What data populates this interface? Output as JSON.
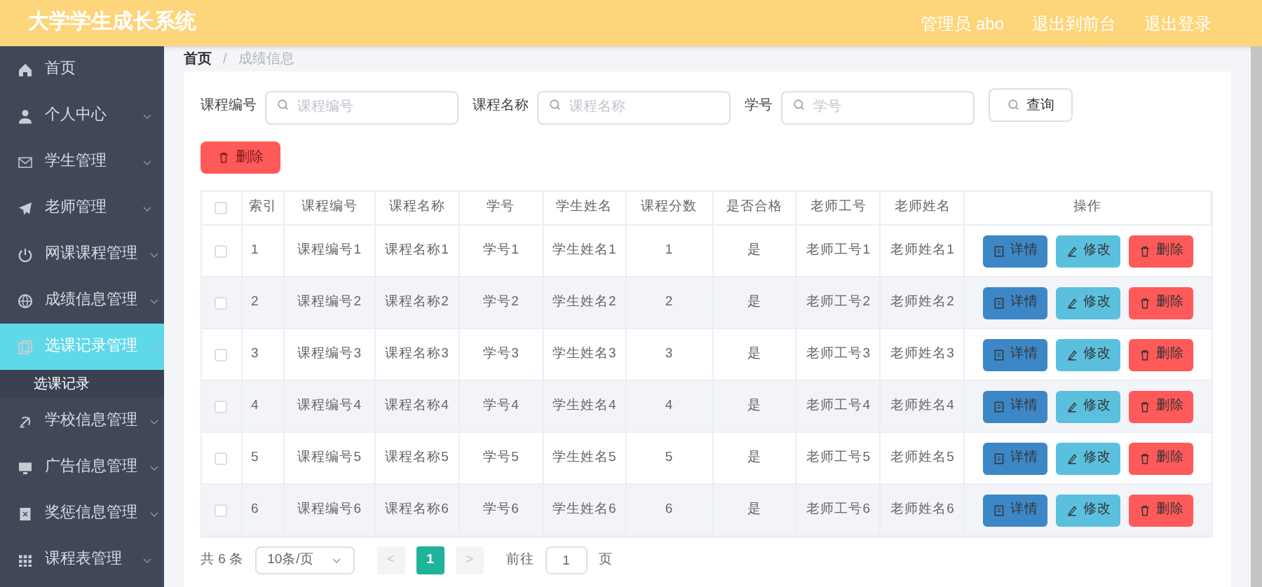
{
  "header": {
    "title": "大学学生成长系统",
    "user": "管理员 abo",
    "links": [
      "退出到前台",
      "退出登录"
    ]
  },
  "sidebar": {
    "items": [
      {
        "label": "首页",
        "kind": "link",
        "selected": false
      },
      {
        "label": "个人中心",
        "kind": "menu",
        "selected": false,
        "expanded": false
      },
      {
        "label": "学生管理",
        "kind": "menu",
        "selected": false,
        "expanded": false
      },
      {
        "label": "老师管理",
        "kind": "menu",
        "selected": false,
        "expanded": false
      },
      {
        "label": "网课课程管理",
        "kind": "menu",
        "selected": false,
        "expanded": false
      },
      {
        "label": "成绩信息管理",
        "kind": "menu",
        "selected": false,
        "expanded": false
      },
      {
        "label": "选课记录管理",
        "kind": "menu",
        "selected": true,
        "expanded": true,
        "children": [
          {
            "label": "选课记录"
          }
        ]
      },
      {
        "label": "学校信息管理",
        "kind": "menu",
        "selected": false,
        "expanded": false
      },
      {
        "label": "广告信息管理",
        "kind": "menu",
        "selected": false,
        "expanded": false
      },
      {
        "label": "奖惩信息管理",
        "kind": "menu",
        "selected": false,
        "expanded": false
      },
      {
        "label": "课程表管理",
        "kind": "menu",
        "selected": false,
        "expanded": false
      }
    ]
  },
  "breadcrumb": [
    "首页",
    "/",
    "成绩信息"
  ],
  "filters": [
    {
      "label": "课程编号",
      "placeholder": "课程编号"
    },
    {
      "label": "课程名称",
      "placeholder": "课程名称"
    },
    {
      "label": "学号",
      "placeholder": "学号"
    }
  ],
  "search_button": "查询",
  "delete_button": "删除",
  "table": {
    "select_all_checked": false,
    "columns": [
      "索引",
      "课程编号",
      "课程名称",
      "学号",
      "学生姓名",
      "课程分数",
      "是否合格",
      "老师工号",
      "老师姓名",
      "操作"
    ],
    "rows": [
      {
        "checked": false,
        "cells": [
          "1",
          "课程编号1",
          "课程名称1",
          "学号1",
          "学生姓名1",
          "1",
          "是",
          "老师工号1",
          "老师姓名1"
        ],
        "actions": [
          {
            "kind": "detail",
            "label": "详情"
          },
          {
            "kind": "edit",
            "label": "修改"
          },
          {
            "kind": "delete",
            "label": "删除"
          }
        ]
      },
      {
        "checked": false,
        "cells": [
          "2",
          "课程编号2",
          "课程名称2",
          "学号2",
          "学生姓名2",
          "2",
          "是",
          "老师工号2",
          "老师姓名2"
        ],
        "actions": [
          {
            "kind": "detail",
            "label": "详情"
          },
          {
            "kind": "edit",
            "label": "修改"
          },
          {
            "kind": "delete",
            "label": "删除"
          }
        ]
      },
      {
        "checked": false,
        "cells": [
          "3",
          "课程编号3",
          "课程名称3",
          "学号3",
          "学生姓名3",
          "3",
          "是",
          "老师工号3",
          "老师姓名3"
        ],
        "actions": [
          {
            "kind": "detail",
            "label": "详情"
          },
          {
            "kind": "edit",
            "label": "修改"
          },
          {
            "kind": "delete",
            "label": "删除"
          }
        ]
      },
      {
        "checked": false,
        "cells": [
          "4",
          "课程编号4",
          "课程名称4",
          "学号4",
          "学生姓名4",
          "4",
          "是",
          "老师工号4",
          "老师姓名4"
        ],
        "actions": [
          {
            "kind": "detail",
            "label": "详情"
          },
          {
            "kind": "edit",
            "label": "修改"
          },
          {
            "kind": "delete",
            "label": "删除"
          }
        ]
      },
      {
        "checked": false,
        "cells": [
          "5",
          "课程编号5",
          "课程名称5",
          "学号5",
          "学生姓名5",
          "5",
          "是",
          "老师工号5",
          "老师姓名5"
        ],
        "actions": [
          {
            "kind": "detail",
            "label": "详情"
          },
          {
            "kind": "edit",
            "label": "修改"
          },
          {
            "kind": "delete",
            "label": "删除"
          }
        ]
      },
      {
        "checked": false,
        "cells": [
          "6",
          "课程编号6",
          "课程名称6",
          "学号6",
          "学生姓名6",
          "6",
          "是",
          "老师工号6",
          "老师姓名6"
        ],
        "actions": [
          {
            "kind": "detail",
            "label": "详情"
          },
          {
            "kind": "edit",
            "label": "修改"
          },
          {
            "kind": "delete",
            "label": "删除"
          }
        ]
      }
    ]
  },
  "pagination": {
    "total": "共 6 条",
    "page_size": "10条/页",
    "prev": "<",
    "pages": [
      {
        "label": "1",
        "selected": true
      }
    ],
    "next": ">",
    "goto_label": "前往",
    "goto_value": "1",
    "goto_suffix": "页"
  }
}
